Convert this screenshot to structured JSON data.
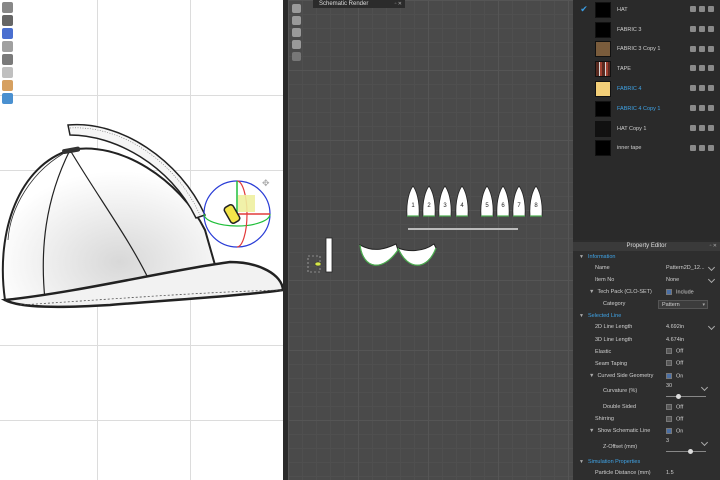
{
  "view2d": {
    "tab_title": "Schematic Render",
    "piece_labels": [
      "1",
      "2",
      "3",
      "4",
      "5",
      "6",
      "7",
      "8"
    ]
  },
  "fabrics": [
    {
      "name": "HAT",
      "swatch": "#000000",
      "checked": true,
      "highlight": false
    },
    {
      "name": "FABRIC 3",
      "swatch": "#000000",
      "checked": false,
      "highlight": false
    },
    {
      "name": "FABRIC 3 Copy 1",
      "swatch": "#7a5c3c",
      "checked": false,
      "highlight": false
    },
    {
      "name": "TAPE",
      "swatch": "#5a2a20",
      "checked": false,
      "highlight": false
    },
    {
      "name": "FABRIC 4",
      "swatch": "#f3cf78",
      "checked": false,
      "highlight": true
    },
    {
      "name": "FABRIC 4 Copy 1",
      "swatch": "#000000",
      "checked": false,
      "highlight": true
    },
    {
      "name": "HAT Copy 1",
      "swatch": "#111111",
      "checked": false,
      "highlight": false
    },
    {
      "name": "inner tape",
      "swatch": "#000000",
      "checked": false,
      "highlight": false
    }
  ],
  "property_editor": {
    "title": "Property Editor",
    "information": {
      "section": "Information",
      "name_label": "Name",
      "name_value": "Pattern2D_12...",
      "item_no_label": "Item No",
      "item_no_value": "None",
      "tech_pack_label": "Tech Pack (CLO-SET)",
      "tech_pack_value": "Include",
      "category_label": "Category",
      "category_value": "Pattern"
    },
    "selected_line": {
      "section": "Selected Line",
      "len2d_label": "2D Line Length",
      "len2d_value": "4.692in",
      "len3d_label": "3D Line Length",
      "len3d_value": "4.674in",
      "elastic_label": "Elastic",
      "elastic_value": "Off",
      "seam_label": "Seam Taping",
      "seam_value": "Off",
      "curved_label": "Curved Side Geometry",
      "curved_value": "On",
      "curvature_label": "Curvature (%)",
      "curvature_value": "30",
      "curvature_level": 0.3,
      "double_label": "Double Sided",
      "double_value": "Off",
      "shirring_label": "Shirring",
      "shirring_value": "Off",
      "schematic_label": "Show Schematic Line",
      "schematic_value": "On",
      "zoffset_label": "Z-Offset (mm)",
      "zoffset_value": "3",
      "zoffset_level": 0.6
    },
    "simulation": {
      "section": "Simulation Properties",
      "particle_label": "Particle Distance (mm)",
      "particle_value": "1.5"
    }
  }
}
